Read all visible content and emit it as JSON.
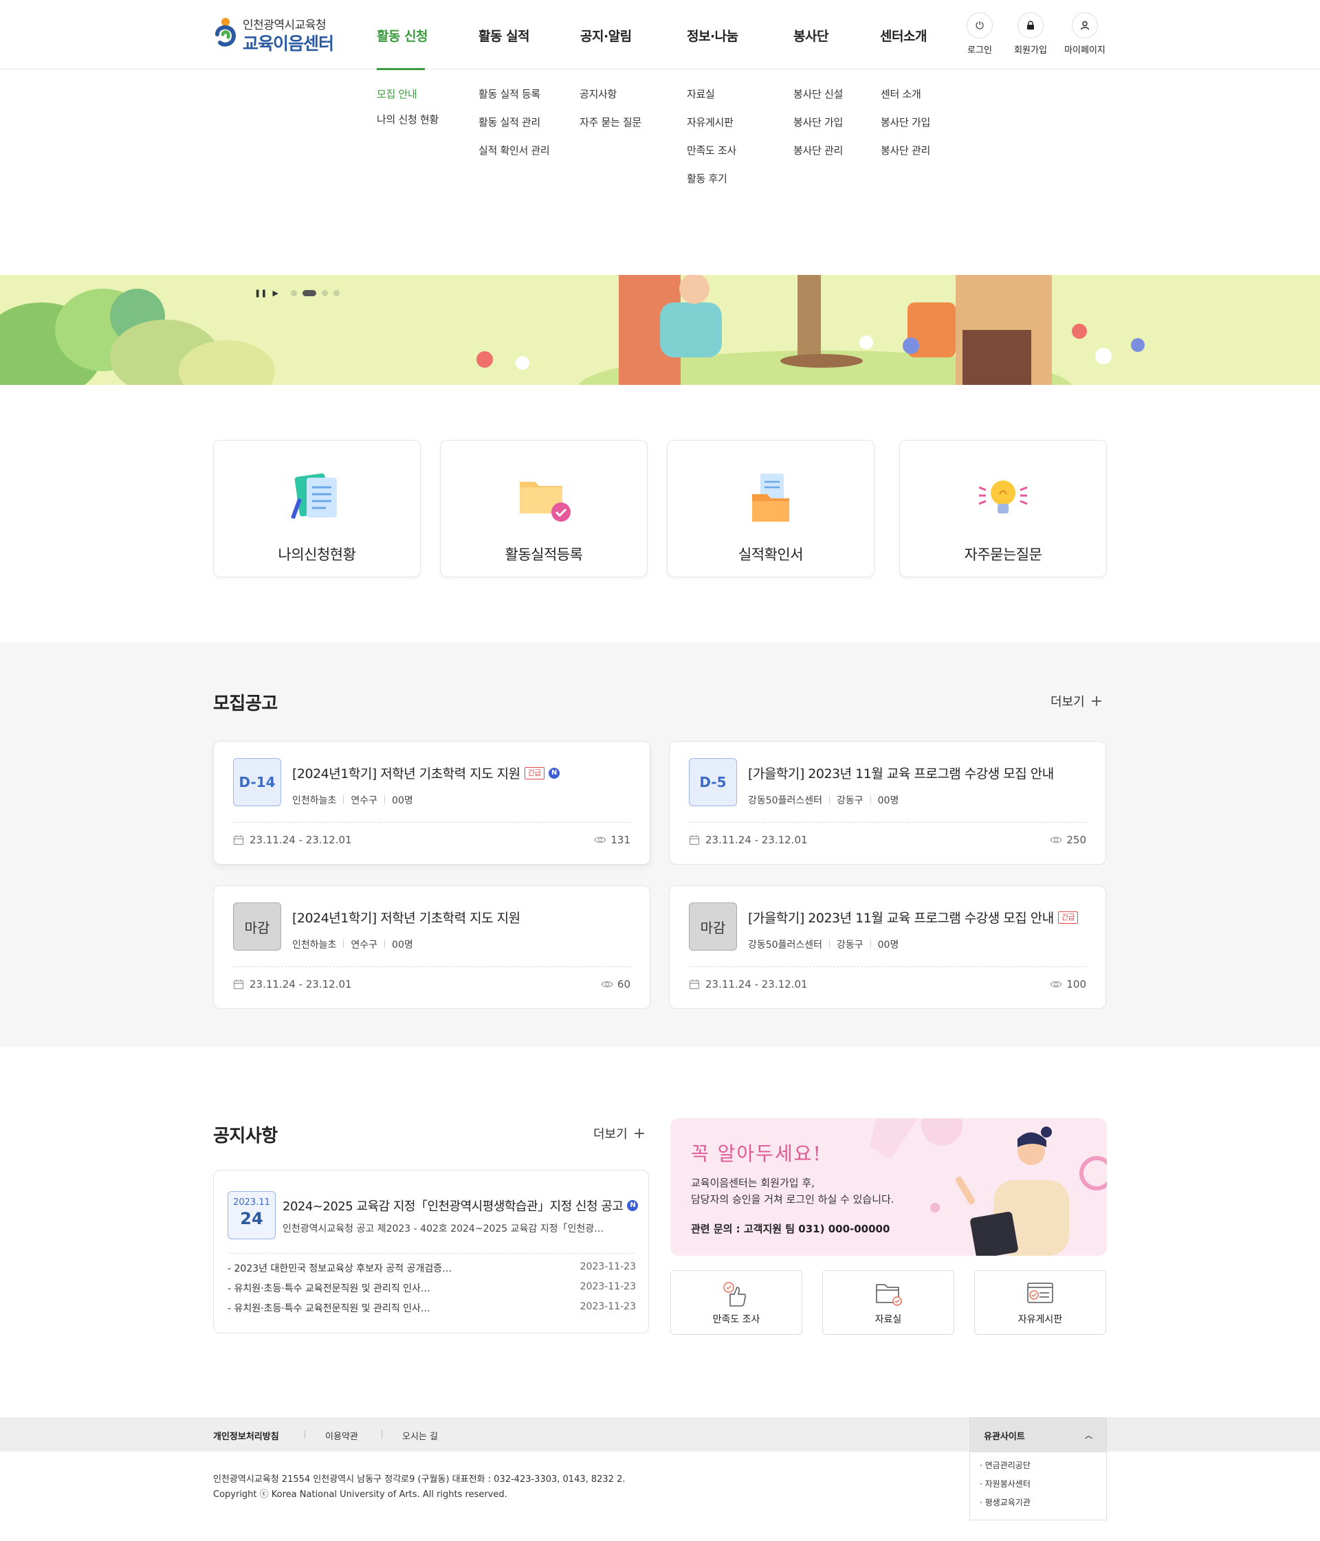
{
  "logo": {
    "org": "인천광역시교육청",
    "name": "교육이음센터"
  },
  "gnb": [
    {
      "label": "활동 신청",
      "subs": [
        "모집 안내",
        "나의 신청 현황"
      ]
    },
    {
      "label": "활동 실적",
      "subs": [
        "활동 실적 등록",
        "활동 실적 관리",
        "실적 확인서 관리"
      ]
    },
    {
      "label": "공지·알림",
      "subs": [
        "공지사항",
        "자주 묻는 질문"
      ]
    },
    {
      "label": "정보·나눔",
      "subs": [
        "자료실",
        "자유게시판",
        "만족도 조사",
        "활동 후기"
      ]
    },
    {
      "label": "봉사단",
      "subs": [
        "봉사단 신설",
        "봉사단 가입",
        "봉사단 관리"
      ]
    },
    {
      "label": "센터소개",
      "subs": [
        "센터 소개",
        "봉사단 가입",
        "봉사단 관리"
      ]
    }
  ],
  "util": {
    "login": "로그인",
    "join": "회원가입",
    "mypage": "마이페이지"
  },
  "quick": [
    "나의신청현황",
    "활동실적등록",
    "실적확인서",
    "자주묻는질문"
  ],
  "recruit": {
    "title": "모집공고",
    "more": "더보기",
    "cards": [
      {
        "badge": "D-14",
        "title": "[2024년1학기] 저학년 기초학력 지도 지원",
        "urgent": "긴급",
        "new": "N",
        "org": "인천하늘초",
        "area": "연수구",
        "people": "00명",
        "period": "23.11.24 - 23.12.01",
        "views": "131"
      },
      {
        "badge": "D-5",
        "title": "[가을학기] 2023년 11월 교육 프로그램 수강생 모집 안내",
        "org": "강동50플러스센터",
        "area": "강동구",
        "people": "00명",
        "period": "23.11.24 - 23.12.01",
        "views": "250"
      },
      {
        "badge": "마감",
        "title": "[2024년1학기] 저학년 기초학력 지도 지원",
        "org": "인천하늘초",
        "area": "연수구",
        "people": "00명",
        "period": "23.11.24 - 23.12.01",
        "views": "60"
      },
      {
        "badge": "마감",
        "title": "[가을학기] 2023년 11월 교육 프로그램 수강생 모집 안내",
        "urgent": "긴급",
        "org": "강동50플러스센터",
        "area": "강동구",
        "people": "00명",
        "period": "23.11.24 - 23.12.01",
        "views": "100"
      }
    ]
  },
  "notice": {
    "title": "공지사항",
    "more": "더보기",
    "top": {
      "ym": "2023.11",
      "day": "24",
      "title": "2024~2025 교육감 지정「인천광역시평생학습관」지정 신청 공고",
      "new": "N",
      "desc": "인천광역시교육청 공고 제2023 - 402호 2024~2025 교육감 지정「인천광…"
    },
    "rows": [
      {
        "title": "- 2023년 대한민국 정보교육상 후보자 공적 공개검증…",
        "date": "2023-11-23"
      },
      {
        "title": "- 유치원·초등·특수 교육전문직원 및 관리직 인사…",
        "date": "2023-11-23"
      },
      {
        "title": "- 유치원·초등·특수 교육전문직원 및 관리직 인사…",
        "date": "2023-11-23"
      }
    ]
  },
  "info": {
    "heading": "꼭 알아두세요!",
    "line1": "교육이음센터는 회원가입 후,",
    "line2": "담당자의 승인을 거쳐 로그인 하실 수 있습니다.",
    "contact": "관련 문의 : 고객지원 팀 031) 000-00000"
  },
  "shortcuts": [
    "만족도 조사",
    "자료실",
    "자유게시판"
  ],
  "footer": {
    "links": [
      "개인정보처리방침",
      "이용약관",
      "오시는 길"
    ],
    "address": "인천광역시교육청 21554 인천광역시 남동구 정각로9 (구월동) 대표전화 : 032-423-3303, 0143, 8232 2.",
    "copyright": "Copyright ⓒ Korea National University of Arts. All rights reserved.",
    "related_title": "유관사이트",
    "related": [
      "· 연금관리공단",
      "· 자원봉사센터",
      "· 평생교육기관"
    ]
  },
  "colors": {
    "accent": "#3b9a3b",
    "primary": "#2c5aa0",
    "urgent": "#e34a4a",
    "pink": "#e05a93"
  }
}
